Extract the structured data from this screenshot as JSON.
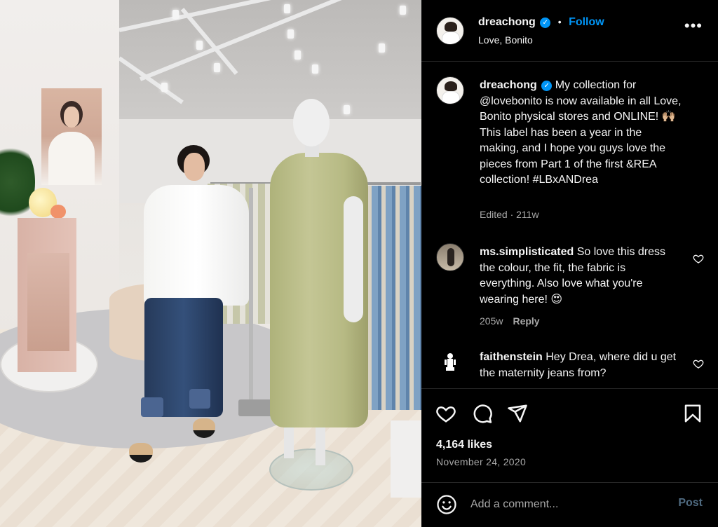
{
  "post": {
    "author": "dreachong",
    "location": "Love, Bonito",
    "follow_label": "Follow",
    "separator": "•",
    "more_icon": "more-options-icon"
  },
  "caption": {
    "username": "dreachong",
    "text": "My collection for @lovebonito is now available in all Love, Bonito physical stores and ONLINE! 🙌🏼 This label has been a year in the making, and I hope you guys love the pieces from Part 1 of the first &REA collection! #LBxANDrea",
    "meta": "Edited · 211w"
  },
  "comments": [
    {
      "username": "ms.simplisticated",
      "text": "So love this dress the colour, the fit, the fabric is everything. Also love what you're wearing here! 😍",
      "time": "205w",
      "reply_label": "Reply"
    },
    {
      "username": "faithenstein",
      "text": "Hey Drea, where did u get the maternity jeans from?"
    }
  ],
  "stats": {
    "likes": "4,164 likes",
    "date": "November 24, 2020"
  },
  "add_comment": {
    "placeholder": "Add a comment...",
    "post_label": "Post"
  },
  "colors": {
    "accent": "#0095f6",
    "panel_bg": "#000000",
    "muted": "#a8a8a8",
    "verified": "#0095f6"
  }
}
